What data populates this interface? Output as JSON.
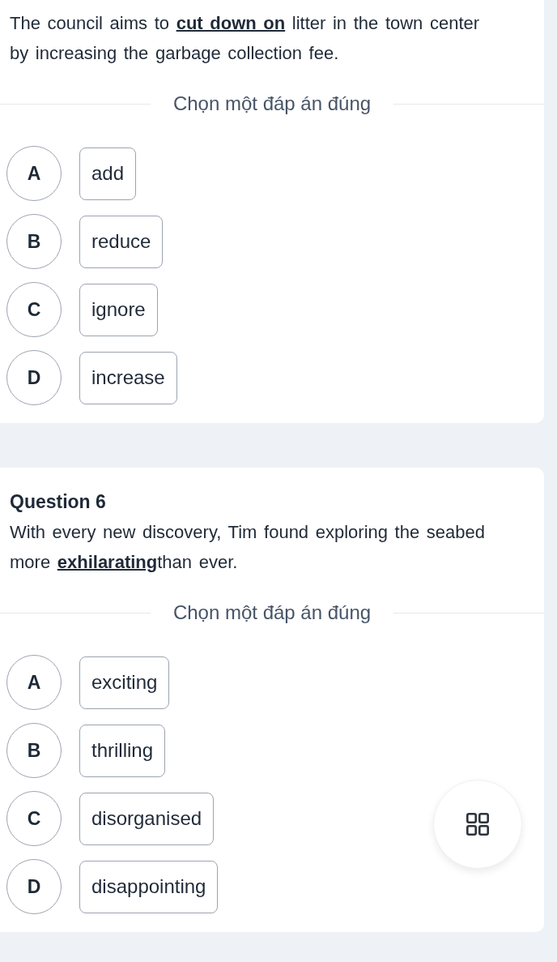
{
  "questions": [
    {
      "text": "The council aims to **cut down on** litter in the town center by increasing the garbage collection fee.",
      "prompt": "Chọn một đáp án đúng",
      "options": [
        {
          "letter": "A",
          "text": "add",
          "selected": false
        },
        {
          "letter": "B",
          "text": "reduce",
          "selected": false
        },
        {
          "letter": "C",
          "text": "ignore",
          "selected": false
        },
        {
          "letter": "D",
          "text": "increase",
          "selected": false
        }
      ]
    },
    {
      "title": "Question 6",
      "text": "With every new discovery, Tim found exploring the seabed more **exhilarating**than ever.",
      "prompt": "Chọn một đáp án đúng",
      "options": [
        {
          "letter": "A",
          "text": "exciting",
          "selected": false
        },
        {
          "letter": "B",
          "text": "thrilling",
          "selected": false
        },
        {
          "letter": "C",
          "text": "disorganised",
          "selected": false
        },
        {
          "letter": "D",
          "text": "disappointing",
          "selected": false
        }
      ]
    }
  ]
}
